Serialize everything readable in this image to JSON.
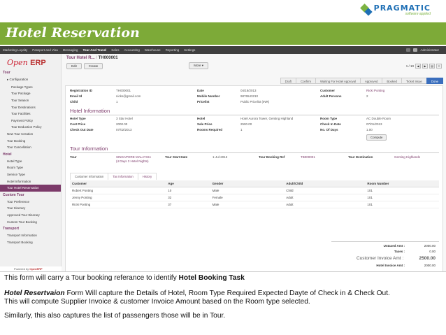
{
  "slide": {
    "logo_text": "PRAGMATIC",
    "logo_sub": "software applied",
    "title": "Hotel Reservation"
  },
  "topmenu": {
    "items": [
      "Marketing Loyalty",
      "Passport and Visa",
      "Messaging",
      "Tour And Travel",
      "Sales",
      "Accounting",
      "Warehouse",
      "Reporting",
      "Settings"
    ],
    "active_index": 3,
    "user": "Administrator"
  },
  "sidebar": {
    "logo": "Open",
    "logo_bold": "ERP",
    "tour_header": "Tour",
    "configuration": "Configuration",
    "config_items": [
      "Package Types",
      "Tour Package",
      "Tour Season",
      "Tour Destinations",
      "Tour Facilities",
      "Payment Policy",
      "Tour Deduction Policy"
    ],
    "tour_items": [
      "New Tour Creation",
      "Tour Booking",
      "Tour Cancellation"
    ],
    "hotel_header": "Hotel",
    "hotel_items": [
      "Hotel Type",
      "Room Type",
      "Service Type",
      "Hotel Information",
      "Tour Hotel Reservation"
    ],
    "custom_header": "Custom Tour",
    "custom_items": [
      "Tour Preference",
      "Tour Itinerary",
      "Approved Tour Itinerary",
      "Custom Tour Booking"
    ],
    "transport_header": "Transport",
    "transport_items": [
      "Transport Information",
      "Transport Booking"
    ],
    "footer": "Powered by",
    "footer_bold": "OpenERP"
  },
  "breadcrumb": {
    "parent": "Tour Hotel R...",
    "sep": " / ",
    "current": "TH000001"
  },
  "toolbar": {
    "edit": "Edit",
    "create": "Create",
    "more": "More",
    "pager": "1 / 10"
  },
  "status": [
    "Draft",
    "Confirm",
    "Waiting For Hotel Approval",
    "Approved",
    "Booked",
    "Ticket Issue",
    "Done"
  ],
  "form": {
    "registration_id_label": "Registration ID",
    "registration_id": "TH000001",
    "email_label": "Email Id",
    "email": "nicks@gmail.com",
    "child_label": "Child",
    "child": "1",
    "date_label": "Date",
    "date": "04/18/2013",
    "mobile_label": "Mobile Number",
    "mobile": "9876543210",
    "pricelist_label": "Pricelist",
    "pricelist": "Public Pricelist (INR)",
    "customer_label": "Customer",
    "customer": "Ricki Ponting",
    "adult_label": "Adult Persons",
    "adult": "2"
  },
  "hotel_info": {
    "title": "Hotel Information",
    "hotel_type_label": "Hotel Type",
    "hotel_type": "3 Star Hotel",
    "cost_price_label": "Cost Price",
    "cost_price": "2000.00",
    "checkout_label": "Check Out Date",
    "checkout": "07/02/2013",
    "hotel_label": "Hotel",
    "hotel": "Hotel Aurora Tower, Genting Highland",
    "sale_price_label": "Sale Price",
    "sale_price": "2500.00",
    "rooms_label": "Rooms Required",
    "rooms": "1",
    "room_type_label": "Room Type",
    "room_type": "AC Double Room",
    "checkin_label": "Check In Date",
    "checkin": "07/01/2013",
    "nights_label": "No. Of Days",
    "nights": "1.00",
    "compute": "Compute"
  },
  "tour_info": {
    "title": "Tour Information",
    "tour_label": "Tour",
    "tour": "SINGAPORE MALAYSIA",
    "tour_sub": "(4 Days 3 Hotel Nights)",
    "start_label": "Tour Start Date",
    "start": "1-Jul-2013",
    "booking_label": "Tour Booking Ref",
    "booking": "TB000001",
    "dest_label": "Tour Destination",
    "dest": "Genting Highlands"
  },
  "tabs": [
    "Customer Information",
    "Tax Information",
    "History"
  ],
  "passengers": {
    "headers": [
      "Customer",
      "Age",
      "Gender",
      "Adult/Child",
      "Room Number"
    ],
    "rows": [
      [
        "Robert Ponting",
        "10",
        "Male",
        "Child",
        "101"
      ],
      [
        "Jenny Ponting",
        "32",
        "Female",
        "Adult",
        "101"
      ],
      [
        "Ricki Ponting",
        "37",
        "Male",
        "Adult",
        "101"
      ]
    ]
  },
  "totals": {
    "untaxed_label": "Untaxed Amt :",
    "untaxed": "2000.00",
    "taxes_label": "Taxes :",
    "taxes": "0.00",
    "customer_label": "Customer Invoice Amt :",
    "customer": "2500.00",
    "hotel_label": "Hotel Invoice Amt :",
    "hotel": "2000.00"
  },
  "caption": {
    "line1": "This form will carry a Tour booking referance to identify",
    "line1_bold": "Hotel Booking Task",
    "line2_bold": "Hotel Resertvaion",
    "line2": "Form Will capture the Details of Hotel, Room Type Required Expected Dayte of Check in & Check Out.",
    "line3": "This will compute Supplier Invoice & customer Invoice Amount based on the Room type selected.",
    "line4": "Similarly, this also captures the list of passengers those will be in Tour."
  }
}
